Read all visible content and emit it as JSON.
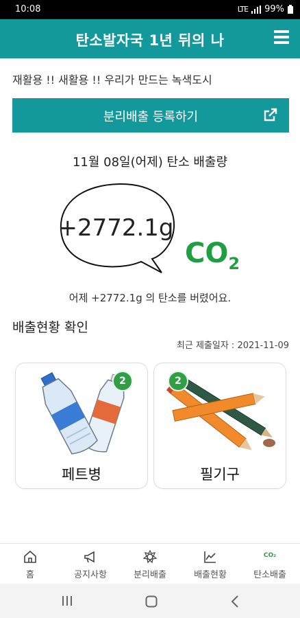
{
  "status_bar": {
    "time": "10:08",
    "network": "LTE",
    "battery": "99%"
  },
  "app_bar": {
    "title": "탄소발자국 1년 뒤의 나"
  },
  "slogan": "재활용 !! 새활용 !! 우리가 만드는 녹색도시",
  "register_button": {
    "label": "분리배출 등록하기"
  },
  "emission": {
    "date_title": "11월 08일(어제) 탄소 배출량",
    "value": "+2772.1g",
    "co2_main": "CO",
    "co2_sub": "2",
    "summary": "어제 +2772.1g 의 탄소를 버렸어요."
  },
  "status_section": {
    "title": "배출현황 확인",
    "recent_date": "최근 제출일자 : 2021-11-09",
    "cards": [
      {
        "label": "페트병",
        "count": "2",
        "icon": "pet-bottle-icon"
      },
      {
        "label": "필기구",
        "count": "2",
        "icon": "pencil-icon"
      }
    ]
  },
  "bottom_nav": {
    "items": [
      {
        "label": "홈",
        "icon": "home-icon"
      },
      {
        "label": "공지사항",
        "icon": "megaphone-icon"
      },
      {
        "label": "분리배출",
        "icon": "recycle-icon"
      },
      {
        "label": "배출현황",
        "icon": "chart-icon"
      },
      {
        "label": "탄소배출",
        "icon": "co2-icon",
        "icon_text": "CO₂"
      }
    ]
  },
  "colors": {
    "primary": "#13989c",
    "co2_green": "#1f9e42",
    "badge_green": "#2f9e44"
  }
}
